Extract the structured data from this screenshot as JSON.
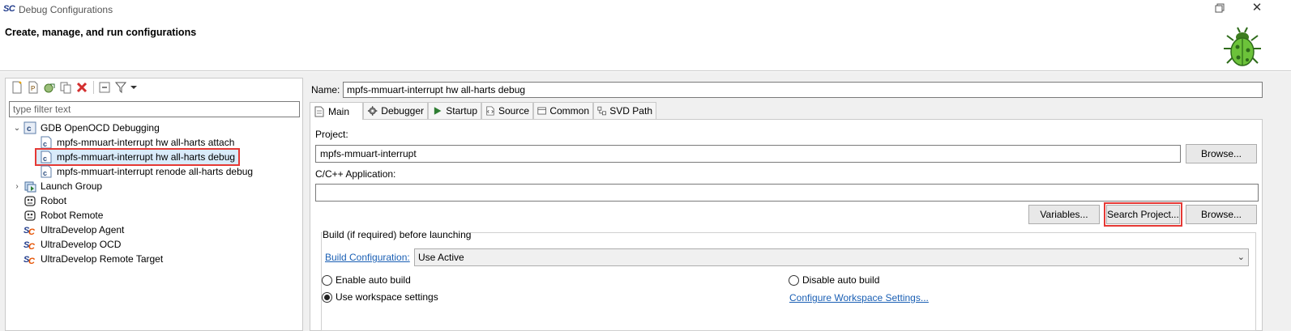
{
  "window": {
    "app_icon": "SC",
    "title": "Debug Configurations"
  },
  "header": {
    "heading": "Create, manage, and run configurations"
  },
  "left": {
    "filter_placeholder": "type filter text",
    "tree": [
      {
        "label": "GDB OpenOCD Debugging",
        "icon": "c-config-icon",
        "expanded": true
      },
      {
        "label": "mpfs-mmuart-interrupt hw all-harts attach",
        "icon": "c-file-icon"
      },
      {
        "label": "mpfs-mmuart-interrupt hw all-harts debug",
        "icon": "c-file-icon",
        "selected": true
      },
      {
        "label": "mpfs-mmuart-interrupt renode all-harts debug",
        "icon": "c-file-icon"
      },
      {
        "label": "Launch Group",
        "icon": "launch-group-icon",
        "expanded": false
      },
      {
        "label": "Robot",
        "icon": "robot-icon"
      },
      {
        "label": "Robot Remote",
        "icon": "robot-remote-icon"
      },
      {
        "label": "UltraDevelop Agent",
        "icon": "sc-icon"
      },
      {
        "label": "UltraDevelop OCD",
        "icon": "sc-icon"
      },
      {
        "label": "UltraDevelop Remote Target",
        "icon": "sc-icon"
      }
    ]
  },
  "right": {
    "name_label": "Name:",
    "name_value": "mpfs-mmuart-interrupt hw all-harts debug",
    "tabs": [
      "Main",
      "Debugger",
      "Startup",
      "Source",
      "Common",
      "SVD Path"
    ],
    "project_label": "Project:",
    "project_value": "mpfs-mmuart-interrupt",
    "browse_label": "Browse...",
    "app_label": "C/C++ Application:",
    "app_value": "",
    "variables_label": "Variables...",
    "search_project_label": "Search Project...",
    "browse2_label": "Browse...",
    "build_group_title": "Build (if required) before launching",
    "build_config_link": "Build Configuration:",
    "build_config_value": "Use Active",
    "enable_auto_build": "Enable auto build",
    "disable_auto_build": "Disable auto build",
    "use_workspace": "Use workspace settings",
    "configure_workspace_link": "Configure Workspace Settings..."
  },
  "colors": {
    "highlight": "#e53935",
    "link": "#1a5fb4"
  }
}
